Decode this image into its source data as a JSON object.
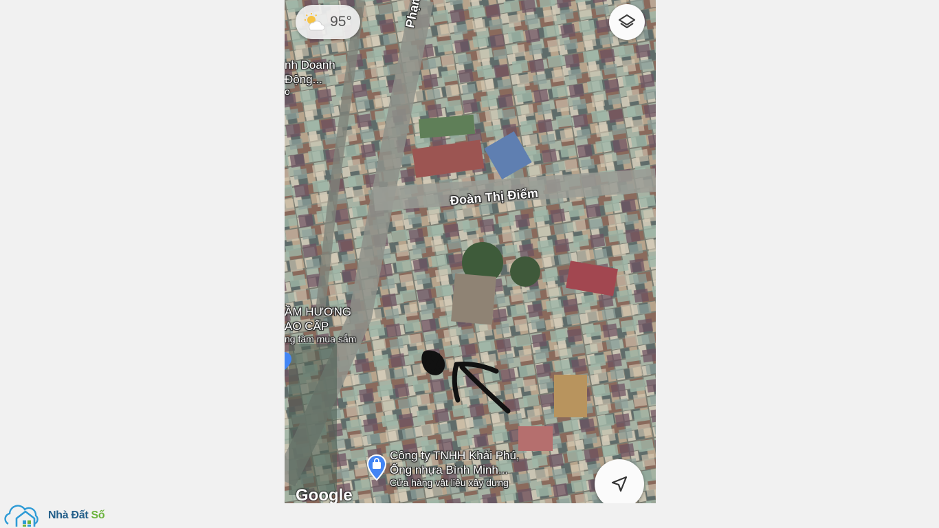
{
  "weather": {
    "icon": "partly-cloudy-icon",
    "temperature": "95°"
  },
  "map_controls": {
    "layers_icon": "layers-icon",
    "locate_icon": "navigation-arrow-icon"
  },
  "streets": {
    "pham_ngu": "Phạm Ngũ",
    "doan_thi_diem": "Đoàn Thị Điểm"
  },
  "places": {
    "business_line1": "nh Doanh",
    "business_line2": "Động...",
    "business_line3": "o",
    "shop_name_line1": "ẦM HƯƠNG",
    "shop_name_line2": "AO CẤP",
    "shop_category": "ng tâm mua sắm",
    "company_line1": "Công ty TNHH Khải Phú,",
    "company_line2": "Ống nhựa Bình Minh...",
    "company_category": "Cửa hàng vật liệu xây dựng"
  },
  "annotation": {
    "icon": "hand-drawn-arrow-icon",
    "marker": "scribble-marker"
  },
  "attribution": "Google",
  "brand": {
    "logo_icon": "house-cloud-logo",
    "part1": "Nhà Đất",
    "part2": "Số"
  },
  "colors": {
    "shop_pin": "#4285f4",
    "annotation": "#111111",
    "brand_blue": "#235f8a",
    "brand_green": "#6ab33c"
  }
}
